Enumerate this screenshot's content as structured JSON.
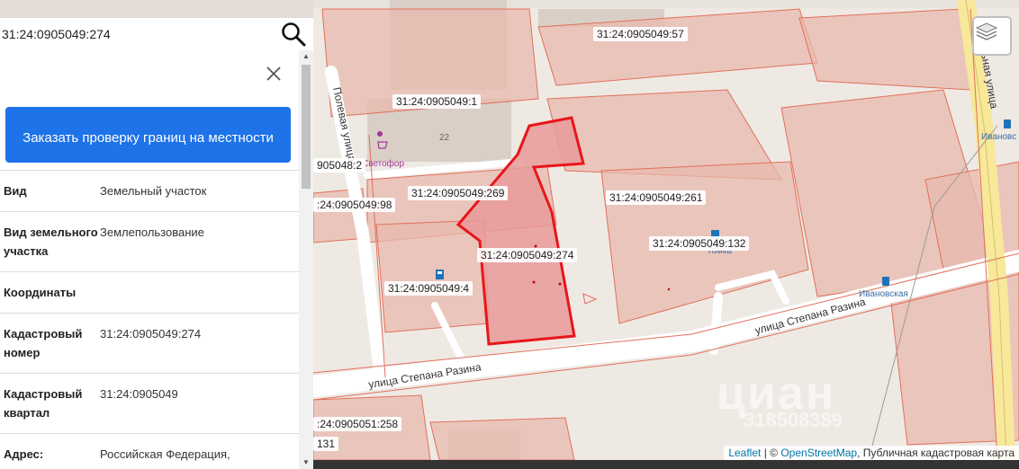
{
  "search": {
    "value": "31:24:0905049:274"
  },
  "panel": {
    "order_button_label": "Заказать проверку границ на местности",
    "rows": [
      {
        "key": "Вид",
        "value": "Земельный участок"
      },
      {
        "key": "Вид земельного участка",
        "value": "Землепользование"
      },
      {
        "key": "Координаты",
        "value": ""
      },
      {
        "key": "Кадастровый номер",
        "value": "31:24:0905049:274"
      },
      {
        "key": "Кадастровый квартал",
        "value": "31:24:0905049"
      },
      {
        "key": "Адрес:",
        "value": "Российская Федерация,"
      }
    ]
  },
  "map": {
    "parcel_labels": [
      "31:24:0905049:57",
      "31:24:0905049:1",
      "905048:2",
      "31:24:0905049:269",
      "31:24:0905049:261",
      ":24:0905049:98",
      "31:24:0905049:132",
      "31:24:0905049:274",
      "31:24:0905049:4",
      ":24:0905051:258",
      "131"
    ],
    "streets": {
      "poleva": "Полевая улица",
      "stepana_razina_1": "улица Степана Разина",
      "stepana_razina_2": "улица Степана Разина",
      "right_street": "ьная улица"
    },
    "pois": {
      "shop": "Светофор",
      "house_number": "22",
      "bus_stop_1": "Ивановская",
      "bus_stop_2": "Ивановс",
      "fuel": "Томка"
    },
    "watermark": {
      "brand": "циан",
      "number": "318508389"
    },
    "attribution": {
      "leaflet": "Leaflet",
      "separator": "| ©",
      "osm": "OpenStreetMap",
      "rest": ", Публичная кадастровая карта"
    },
    "colors": {
      "parcel_fill": "#e8b8ad",
      "parcel_stroke": "#e0705a",
      "selected_fill": "#e89a9a",
      "selected_stroke": "#e8161b",
      "button_blue": "#1e73e8"
    },
    "icons": [
      "layers-icon",
      "search-icon",
      "close-icon",
      "shop-icon",
      "fuel-icon",
      "bus-icon"
    ]
  }
}
